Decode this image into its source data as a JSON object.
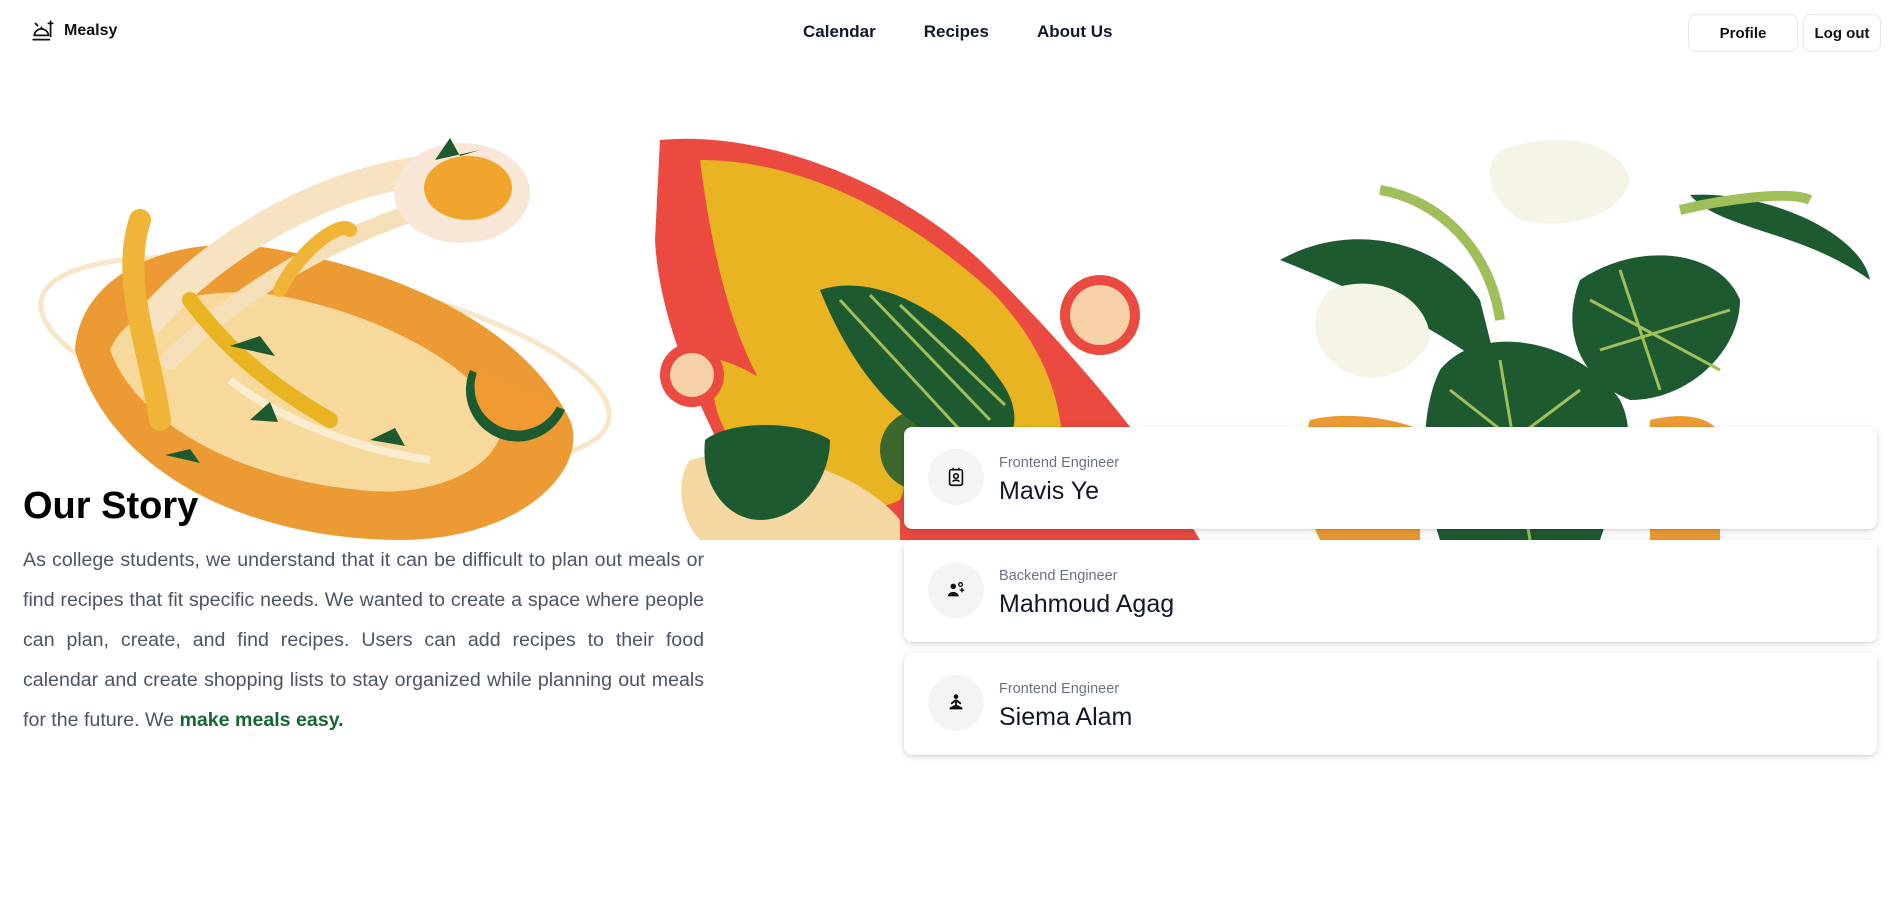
{
  "brand": {
    "name": "Mealsy"
  },
  "nav": {
    "links": [
      "Calendar",
      "Recipes",
      "About Us"
    ]
  },
  "header": {
    "profile_label": "Profile",
    "logout_label": "Log out"
  },
  "story": {
    "title": "Our Story",
    "body": "As college students, we understand that it can be difficult to plan out meals or find recipes that fit specific needs. We wanted to create a space where people can plan, create, and find recipes. Users can add recipes to their food calendar and create shopping lists to stay organized while planning out meals for the future. We ",
    "highlight": "make meals easy."
  },
  "team": [
    {
      "role": "Frontend Engineer",
      "name": "Mavis Ye",
      "icon": "contact-card-icon"
    },
    {
      "role": "Backend Engineer",
      "name": "Mahmoud Agag",
      "icon": "people-group-icon"
    },
    {
      "role": "Frontend Engineer",
      "name": "Siema Alam",
      "icon": "meditation-person-icon"
    }
  ],
  "colors": {
    "accent": "#166534",
    "orange": "#e8902f",
    "yellow": "#e9b422",
    "red": "#ea4a3f",
    "green": "#1d5a2f",
    "cream": "#f7e3c2"
  }
}
